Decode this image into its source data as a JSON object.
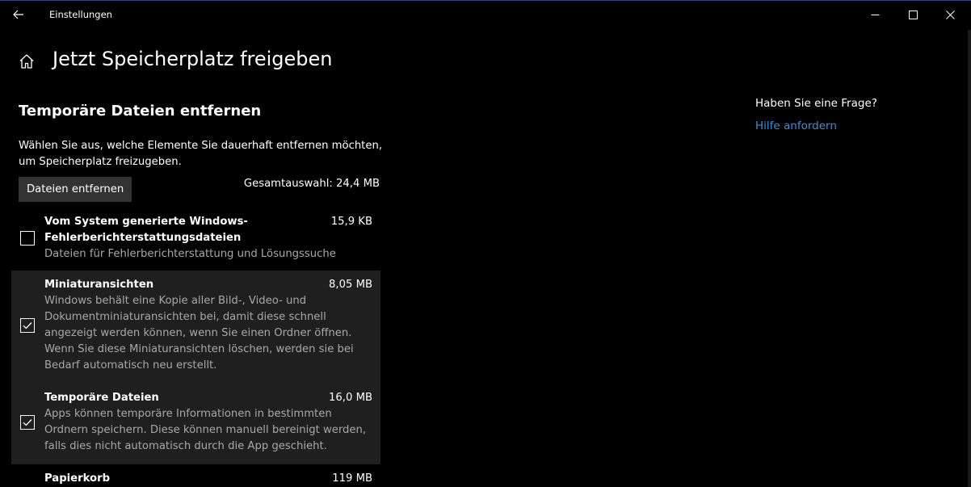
{
  "titlebar": {
    "title": "Einstellungen",
    "back_icon": "back-arrow-icon",
    "minimize_icon": "minimize-icon",
    "maximize_icon": "maximize-icon",
    "close_icon": "close-icon"
  },
  "header": {
    "home_icon": "home-icon",
    "title": "Jetzt Speicherplatz freigeben"
  },
  "section": {
    "title": "Temporäre Dateien entfernen",
    "description": "Wählen Sie aus, welche Elemente Sie dauerhaft entfernen möchten, um Speicherplatz freizugeben.",
    "remove_button_label": "Dateien entfernen",
    "total_selection": "Gesamtauswahl: 24,4 MB"
  },
  "items": [
    {
      "name": "Vom System generierte Windows-Fehlerberichterstattungsdateien",
      "size": "15,9 KB",
      "description": "Dateien für Fehlerberichterstattung und Lösungssuche",
      "checked": false
    },
    {
      "name": "Miniaturansichten",
      "size": "8,05 MB",
      "description": "Windows behält eine Kopie aller Bild-, Video- und Dokumentminiaturansichten bei, damit diese schnell angezeigt werden können, wenn Sie einen Ordner öffnen. Wenn Sie diese Miniaturansichten löschen, werden sie bei Bedarf automatisch neu erstellt.",
      "checked": true
    },
    {
      "name": "Temporäre Dateien",
      "size": "16,0 MB",
      "description": "Apps können temporäre Informationen in bestimmten Ordnern speichern. Diese können manuell bereinigt werden, falls dies nicht automatisch durch die App geschieht.",
      "checked": true
    },
    {
      "name": "Papierkorb",
      "size": "119 MB",
      "description": "",
      "checked": false
    }
  ],
  "help": {
    "question": "Haben Sie eine Frage?",
    "link_label": "Hilfe anfordern"
  },
  "colors": {
    "background": "#000000",
    "selected_row": "#1f1f1f",
    "button": "#333333",
    "link": "#3a8fe0",
    "secondary_text": "#a8a8a8"
  }
}
